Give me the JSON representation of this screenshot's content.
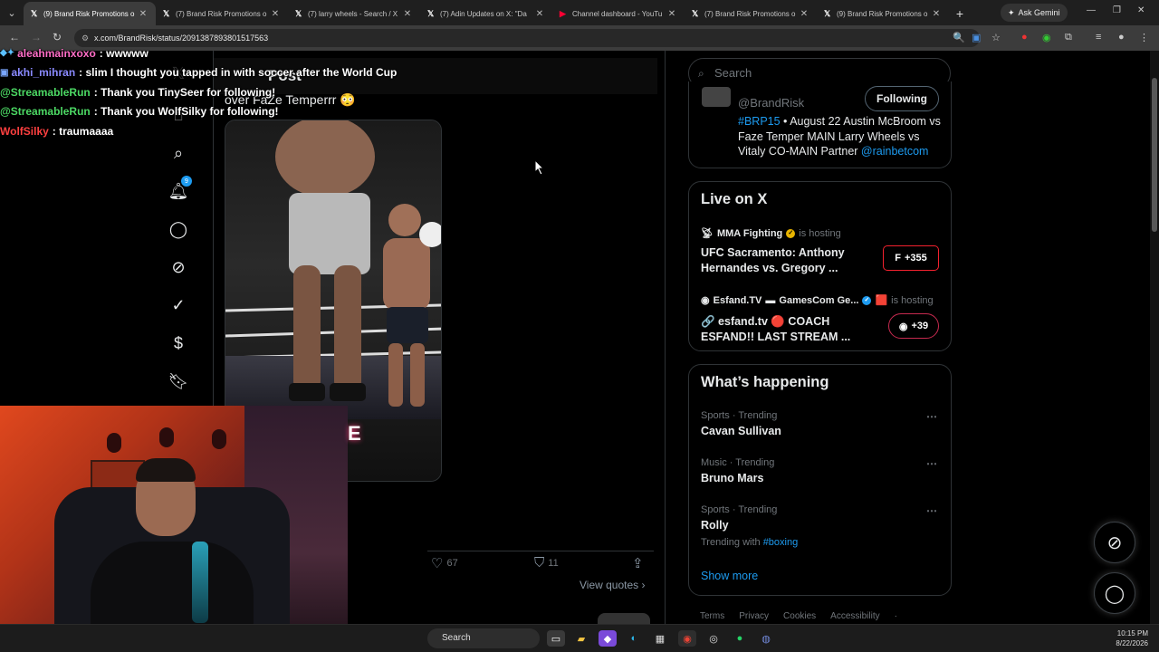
{
  "browser": {
    "tabs": [
      {
        "favicon": "x-logo",
        "title": "(9) Brand Risk Promotions o",
        "active": true
      },
      {
        "favicon": "x-logo",
        "title": "(7) Brand Risk Promotions o",
        "active": false
      },
      {
        "favicon": "x-logo",
        "title": "(7) larry wheels - Search / X",
        "active": false
      },
      {
        "favicon": "x-logo",
        "title": "(7) Adin Updates on X: \"Da",
        "active": false
      },
      {
        "favicon": "youtube-logo",
        "title": "Channel dashboard - YouTu",
        "active": false
      },
      {
        "favicon": "x-logo",
        "title": "(7) Brand Risk Promotions o",
        "active": false
      },
      {
        "favicon": "x-logo",
        "title": "(9) Brand Risk Promotions o",
        "active": false
      }
    ],
    "ask_gemini_label": "Ask Gemini",
    "url": "x.com/BrandRisk/status/2091387893801517563"
  },
  "chat": [
    {
      "user": "aleahmainxoxo",
      "message": "wwwww",
      "color": "#ff6ec7",
      "icon": "badge-icons"
    },
    {
      "user": "akhi_mihran",
      "message": "slim I thought you tapped in with soccer after the World Cup",
      "color": "#8a8aff",
      "icon": "badge-icon"
    },
    {
      "user": "@StreamableRun",
      "message": "Thank you TinySeer for following!",
      "color": "#4cd964",
      "icon": ""
    },
    {
      "user": "@StreamableRun",
      "message": "Thank you WolfSilky for following!",
      "color": "#4cd964",
      "icon": ""
    },
    {
      "user": "WolfSilky",
      "message": "traumaaaa",
      "color": "#ff4040",
      "icon": ""
    }
  ],
  "post": {
    "header_label": "Post",
    "text": "over FaZe Temperrr 😳",
    "likes": "67",
    "bookmarks": "11",
    "view_quotes_label": "View quotes"
  },
  "nav": {
    "notifications_badge": "9"
  },
  "sidebar": {
    "search_placeholder": "Search",
    "profile_card": {
      "handle": "@BrandRisk",
      "follow_label": "Following",
      "bio_hashtag": "#BRP15",
      "bio_text": " • August 22 Austin McBroom vs Faze Temper MAIN Larry Wheels vs Vitaly CO-MAIN Partner ",
      "bio_mention": "@rainbetcom"
    },
    "live": {
      "title": "Live on X",
      "items": [
        {
          "host": "MMA Fighting",
          "hosting_label": "is hosting",
          "title": "UFC Sacramento: Anthony Hernandes vs. Gregory ...",
          "count": "+355"
        },
        {
          "host": "Esfand.TV",
          "cohost": "GamesCom Ge...",
          "hosting_label": "is hosting",
          "title": "🔗 esfand.tv 🔴 COACH ESFAND!! LAST STREAM ...",
          "count": "+39"
        }
      ]
    },
    "happening": {
      "title": "What’s happening",
      "trends": [
        {
          "meta": "Sports · Trending",
          "name": "Cavan Sullivan"
        },
        {
          "meta": "Music · Trending",
          "name": "Bruno Mars"
        },
        {
          "meta": "Sports · Trending",
          "name": "Rolly",
          "with_label": "Trending with",
          "with_tag": "#boxing"
        }
      ],
      "show_more_label": "Show more"
    },
    "footer": [
      "Terms",
      "Privacy",
      "Cookies",
      "Accessibility",
      "·"
    ]
  },
  "taskbar": {
    "search_label": "Search",
    "time": "10:15 PM",
    "date": "8/22/2026"
  },
  "colors": {
    "accent": "#1d9bf0",
    "live_border": "#f4212e"
  }
}
